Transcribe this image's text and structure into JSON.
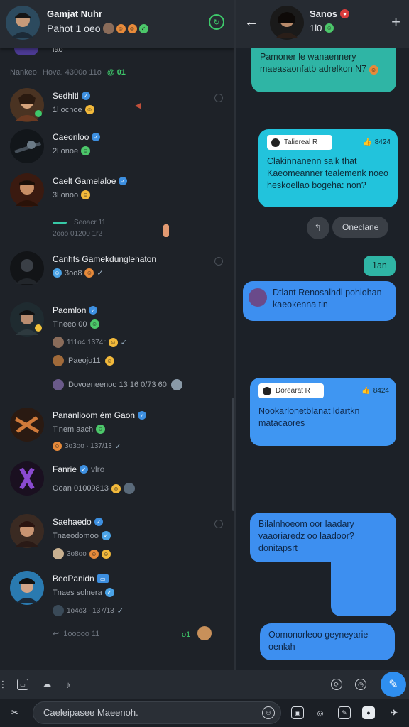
{
  "left_header": {
    "name": "Gamjat Nuhr",
    "subtitle": "Pahot 1 oeo"
  },
  "left_stub": "lao",
  "filter_bar": {
    "label": "Nankeo",
    "meta": "Hova. 4300o 11o",
    "count": "@ 01"
  },
  "chats": [
    {
      "name": "Sedhltl",
      "sub": "1l ochoe",
      "meta": ""
    },
    {
      "name": "Caeonloo",
      "sub": "2l onoe",
      "meta": ""
    },
    {
      "name": "Caelt Gamelaloe",
      "sub": "3l onoo",
      "meta": ""
    },
    {
      "name": "",
      "sub": "Seoacr 11",
      "meta": "2ooo 01200 1r2"
    },
    {
      "name": "Canhts Gamekdunglehaton",
      "sub": "3oo8",
      "meta": ""
    },
    {
      "name": "Paomlon",
      "sub": "Tineeo 00",
      "meta": "111o4 1374r"
    },
    {
      "name": "",
      "sub": "Paeojo11",
      "meta": ""
    },
    {
      "name": "",
      "sub": "Dovoeneenoo 13 16 0/73 60",
      "meta": ""
    },
    {
      "name": "Pananlioom ém Gaon",
      "sub": "Tinem aach",
      "meta": "3o3oo ∙ 137/13"
    },
    {
      "name": "Fanrie",
      "sub": "vlro",
      "meta": "Ooan 01009813"
    },
    {
      "name": "Saehaedo",
      "sub": "Tnaeodomoo",
      "meta": "3o8oo"
    },
    {
      "name": "BeoPanidn",
      "sub": "Tnaes solnera",
      "meta": "1o4o3 ∙ 137/13"
    },
    {
      "name": "",
      "sub": "1ooooo 11",
      "meta": "o1"
    }
  ],
  "right_header": {
    "name": "Sanos",
    "subtitle": "1l0"
  },
  "messages": [
    {
      "text": "Pamoner le wanaennery maeasaonfatb adrelkon N7",
      "style": "teal"
    },
    {
      "chip": "Taliereal R",
      "meta": "8424",
      "text": "Clakinnanenn salk that Kaeomeanner tealemenk noeo heskoellao bogeha: non?",
      "style": "cyan"
    },
    {
      "text": "Oneclane",
      "style": "gray"
    },
    {
      "text": "1an",
      "style": "teal"
    },
    {
      "text": "Dtlant Renosalhdl pohiohan kaeokenna tin",
      "style": "blue"
    },
    {
      "chip": "Dorearat R",
      "meta": "8424",
      "text": "Nookarlonetblanat ldartkn matacaores",
      "style": "blue"
    },
    {
      "text": "Bilalnhoeom oor laadary vaaoriaredz oo laadoor? donitapsrt",
      "style": "blue"
    },
    {
      "text": "Oomonorleoo geyneyarie oenlah",
      "style": "blue"
    }
  ],
  "composer": {
    "placeholder": "Caeleipasee Maeenoh.",
    "attach_label": "Attach"
  }
}
